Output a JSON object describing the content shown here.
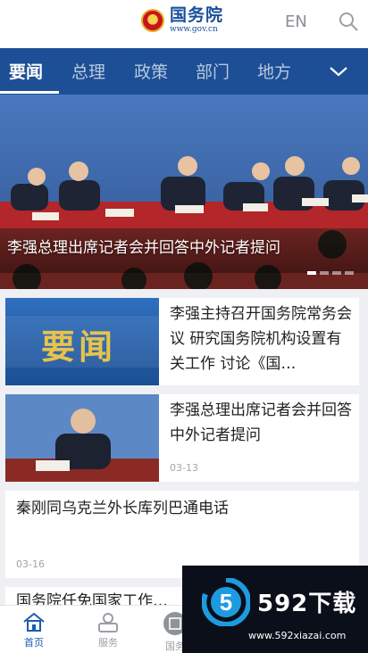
{
  "header": {
    "logo_cn": "国务院",
    "logo_url": "www.gov.cn",
    "lang_label": "EN",
    "search_icon": "search-icon"
  },
  "channels": [
    {
      "label": "要闻",
      "active": true
    },
    {
      "label": "总理",
      "active": false
    },
    {
      "label": "政策",
      "active": false
    },
    {
      "label": "部门",
      "active": false
    },
    {
      "label": "地方",
      "active": false
    }
  ],
  "more_icon": "chevron-down-icon",
  "banner": {
    "caption": "李强总理出席记者会并回答中外记者提问",
    "page_count": 4,
    "current_page": 1
  },
  "news": [
    {
      "title": "李强主持召开国务院常务会议 研究国务院机构设置有关工作 讨论《国…",
      "thumb_text": "要闻",
      "date": ""
    },
    {
      "title": "李强总理出席记者会并回答中外记者提问",
      "thumb_text": "",
      "date": "03-13"
    },
    {
      "title": "秦刚同乌克兰外长库列巴通电话",
      "thumb_text": "",
      "date": "03-16"
    },
    {
      "title": "国务院任免国家工作…",
      "thumb_text": "",
      "date": ""
    }
  ],
  "bottom_nav": [
    {
      "label": "首页",
      "icon": "home-icon",
      "active": true
    },
    {
      "label": "服务",
      "icon": "user-service-icon",
      "active": false
    },
    {
      "label": "国务",
      "icon": "building-icon",
      "active": false
    }
  ],
  "watermark": {
    "mark": "5",
    "text": "592下载",
    "url": "www.592xiazai.com"
  },
  "colors": {
    "brand_blue": "#1c4f95",
    "active_nav": "#1c5bb0",
    "thumb_gold": "#e8c34a"
  }
}
